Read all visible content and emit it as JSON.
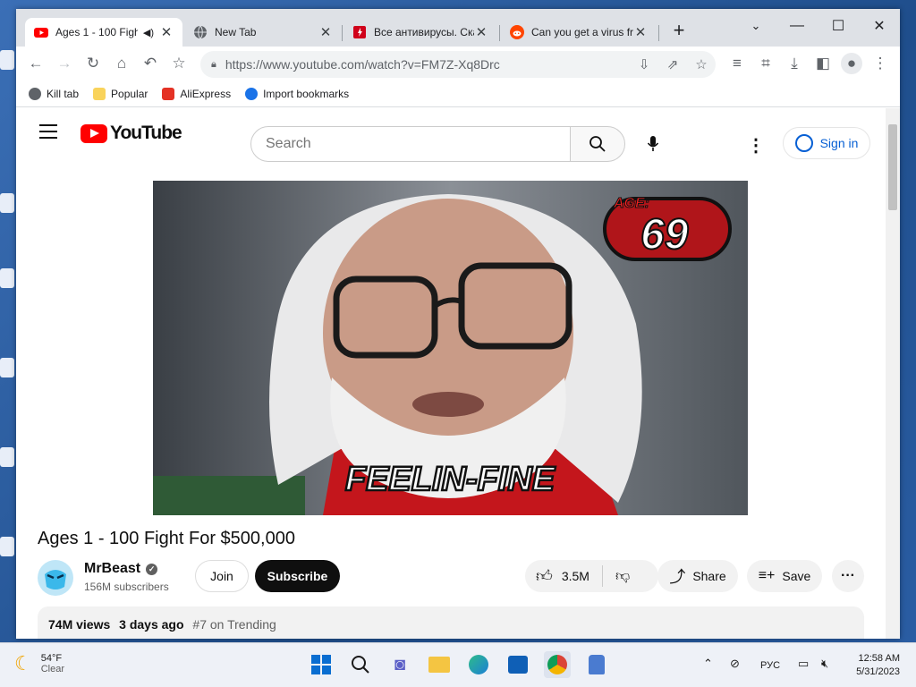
{
  "browser": {
    "tabs": [
      {
        "title": "Ages 1 - 100 Figh",
        "active": true
      },
      {
        "title": "New Tab",
        "active": false
      },
      {
        "title": "Все антивирусы. Ска",
        "active": false
      },
      {
        "title": "Can you get a virus fr",
        "active": false
      }
    ],
    "url": "https://www.youtube.com/watch?v=FM7Z-Xq8Drc",
    "bookmarks": [
      "Kill tab",
      "Popular",
      "AliExpress",
      "Import bookmarks"
    ]
  },
  "youtube": {
    "logo_text": "YouTube",
    "search_placeholder": "Search",
    "signin_label": "Sign in"
  },
  "video": {
    "overlay_age_label": "AGE:",
    "overlay_age": "69",
    "overlay_caption": "FEELIN-FINE",
    "title": "Ages 1 - 100 Fight For $500,000",
    "channel": "MrBeast",
    "subscribers": "156M subscribers",
    "join_label": "Join",
    "subscribe_label": "Subscribe",
    "likes": "3.5M",
    "share_label": "Share",
    "save_label": "Save",
    "views": "74M views",
    "uploaded": "3 days ago",
    "trending": "#7 on Trending"
  },
  "taskbar": {
    "temperature": "54°F",
    "weather": "Clear",
    "language": "РУС",
    "time": "12:58 AM",
    "date": "5/31/2023"
  },
  "colors": {
    "youtube_red": "#ff0000",
    "signin_blue": "#065fd4",
    "subscribe_bg": "#0f0f0f"
  }
}
